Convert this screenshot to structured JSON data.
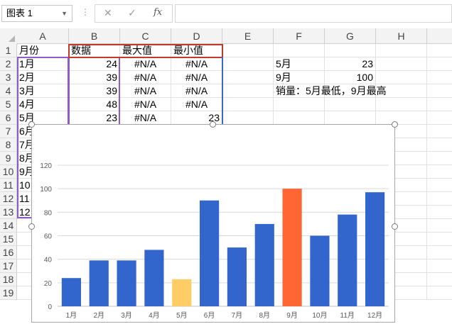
{
  "name_box": {
    "value": "图表 1"
  },
  "formula_bar": {
    "cancel_symbol": "✕",
    "enter_symbol": "✓",
    "fx_symbol": "fx",
    "value": ""
  },
  "columns": [
    "A",
    "B",
    "C",
    "D",
    "E",
    "F",
    "G",
    "H"
  ],
  "rows": [
    "1",
    "2",
    "3",
    "4",
    "5",
    "6",
    "7",
    "8",
    "9",
    "10",
    "11",
    "12",
    "13",
    "14",
    "15",
    "16",
    "17",
    "18",
    "19"
  ],
  "cells": {
    "header": {
      "a": "月份",
      "b": "数据",
      "c": "最大值",
      "d": "最小值"
    },
    "data": [
      {
        "a": "1月",
        "b": "24",
        "c": "#N/A",
        "d": "#N/A"
      },
      {
        "a": "2月",
        "b": "39",
        "c": "#N/A",
        "d": "#N/A"
      },
      {
        "a": "3月",
        "b": "39",
        "c": "#N/A",
        "d": "#N/A"
      },
      {
        "a": "4月",
        "b": "48",
        "c": "#N/A",
        "d": "#N/A"
      },
      {
        "a": "5月",
        "b": "23",
        "c": "#N/A",
        "d": "23"
      },
      {
        "a": "6月"
      },
      {
        "a": "7月"
      },
      {
        "a": "8月"
      },
      {
        "a": "9月"
      },
      {
        "a": "10"
      },
      {
        "a": "11"
      },
      {
        "a": "12"
      }
    ],
    "summary": {
      "f2": "5月",
      "g2": "23",
      "f3": "9月",
      "g3": "100",
      "f4": "销量：5月最低，9月最高"
    }
  },
  "chart_data": {
    "type": "bar",
    "categories": [
      "1月",
      "2月",
      "3月",
      "4月",
      "5月",
      "6月",
      "7月",
      "8月",
      "9月",
      "10月",
      "11月",
      "12月"
    ],
    "values": [
      24,
      39,
      39,
      48,
      23,
      90,
      50,
      70,
      100,
      60,
      78,
      97
    ],
    "ylim": [
      0,
      120
    ],
    "yticks": [
      0,
      20,
      40,
      60,
      80,
      100,
      120
    ],
    "grid": true,
    "colors": {
      "default": "#3366cc",
      "min": "#ffcc66",
      "max": "#ff6633"
    },
    "highlight": {
      "min_index": 4,
      "max_index": 8
    }
  }
}
